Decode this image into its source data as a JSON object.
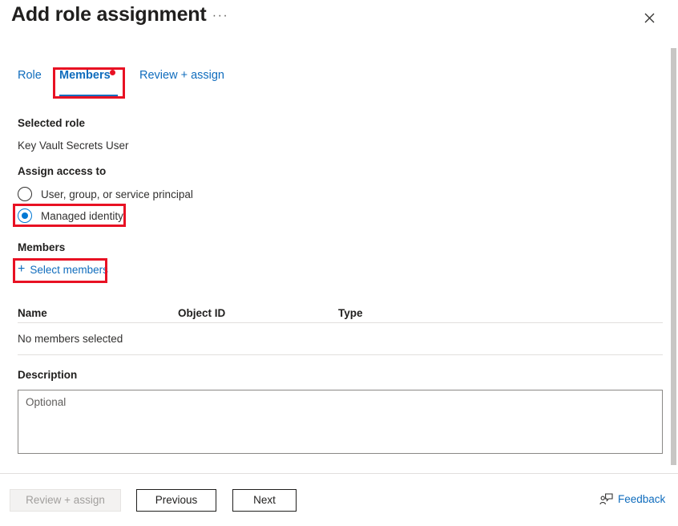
{
  "header": {
    "title": "Add role assignment",
    "ellipsis_label": "···",
    "ellipsis_icon": "more-horizontal-icon",
    "close_icon": "close-icon"
  },
  "tabs": [
    {
      "label": "Role",
      "selected": false
    },
    {
      "label": "Members",
      "selected": true,
      "badge": "attention-dot"
    },
    {
      "label": "Review + assign",
      "selected": false
    }
  ],
  "form": {
    "selected_role_label": "Selected role",
    "selected_role_value": "Key Vault Secrets User",
    "assign_access_label": "Assign access to",
    "assign_access_options": [
      {
        "label": "User, group, or service principal",
        "checked": false
      },
      {
        "label": "Managed identity",
        "checked": true
      }
    ],
    "members_label": "Members",
    "select_members_label": "Select members",
    "select_members_icon": "plus-icon",
    "description_label": "Description",
    "description_value": "",
    "description_placeholder": "Optional"
  },
  "members_table": {
    "columns": [
      "Name",
      "Object ID",
      "Type"
    ],
    "rows": [
      {
        "name": "No members selected",
        "object_id": "",
        "type": ""
      }
    ]
  },
  "footer": {
    "review_assign_label": "Review + assign",
    "review_assign_disabled": true,
    "previous_label": "Previous",
    "next_label": "Next",
    "feedback_label": "Feedback",
    "feedback_icon": "feedback-person-icon"
  },
  "colors": {
    "accent_blue": "#0f6cbd",
    "radio_blue": "#0078d4",
    "annotation_red": "#e81123",
    "text_primary": "#201f1e",
    "text_secondary": "#323130",
    "divider": "#e1dfdd",
    "scrollbar_thumb": "#c8c6c4"
  }
}
